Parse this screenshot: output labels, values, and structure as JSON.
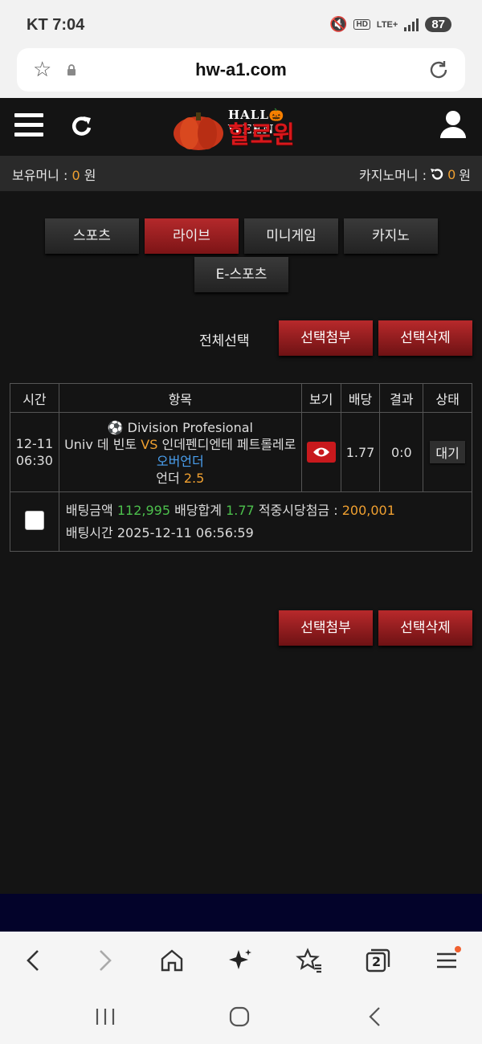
{
  "status_bar": {
    "carrier_time": "KT 7:04",
    "hd": "HD",
    "lte": "LTE+",
    "battery": "87"
  },
  "browser": {
    "url": "hw-a1.com",
    "tab_count": "2"
  },
  "header": {
    "logo_top": "HALL🎃WEEN",
    "logo_main": "할로윈"
  },
  "money": {
    "holding_label": "보유머니 :",
    "holding_value": "0",
    "holding_unit": "원",
    "casino_label": "카지노머니 :",
    "casino_value": "0",
    "casino_unit": "원"
  },
  "tabs": [
    "스포츠",
    "라이브",
    "미니게임",
    "카지노",
    "E-스포츠"
  ],
  "active_tab": "라이브",
  "actions": {
    "select_all": "전체선택",
    "attach": "선택첨부",
    "delete": "선택삭제"
  },
  "table": {
    "headers": [
      "시간",
      "항목",
      "보기",
      "배당",
      "결과",
      "상태"
    ],
    "bet": {
      "date": "12-11",
      "time": "06:30",
      "league_icon": "soccer-ball-icon",
      "league": "Division Profesional",
      "home": "Univ 데 빈토",
      "vs": "VS",
      "away": "인데펜디엔테 페트롤레로",
      "market": "오버언더",
      "pick": "언더",
      "pick_line": "2.5",
      "odds": "1.77",
      "result": "0:0",
      "status": "대기",
      "amount_label": "배팅금액",
      "amount": "112,995",
      "total_odds_label": "배당합계",
      "total_odds": "1.77",
      "payout_label": "적중시당첨금 :",
      "payout": "200,001",
      "bet_time_label": "배팅시간",
      "bet_time": "2025-12-11 06:56:59"
    }
  },
  "colors": {
    "accent_red": "#b4292b",
    "odds_green": "#4cc04c",
    "value_orange": "#f0a030",
    "market_blue": "#4aa0f0",
    "footer_navy": "#03032a"
  }
}
